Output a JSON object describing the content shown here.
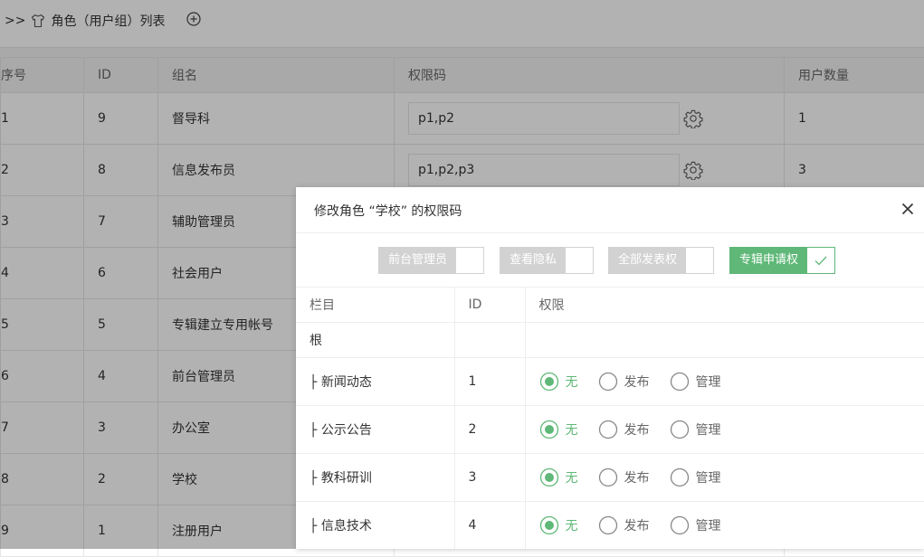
{
  "header": {
    "prefix": ">>",
    "title": "角色（用户组）列表"
  },
  "table": {
    "columns": [
      "序号",
      "ID",
      "组名",
      "权限码",
      "用户数量"
    ],
    "rows": [
      {
        "index": "1",
        "id": "9",
        "name": "督导科",
        "perm": "p1,p2",
        "count": "1"
      },
      {
        "index": "2",
        "id": "8",
        "name": "信息发布员",
        "perm": "p1,p2,p3",
        "count": "3"
      },
      {
        "index": "3",
        "id": "7",
        "name": "辅助管理员"
      },
      {
        "index": "4",
        "id": "6",
        "name": "社会用户"
      },
      {
        "index": "5",
        "id": "5",
        "name": "专辑建立专用帐号"
      },
      {
        "index": "6",
        "id": "4",
        "name": "前台管理员"
      },
      {
        "index": "7",
        "id": "3",
        "name": "办公室"
      },
      {
        "index": "8",
        "id": "2",
        "name": "学校"
      },
      {
        "index": "9",
        "id": "1",
        "name": "注册用户"
      }
    ]
  },
  "modal": {
    "title": "修改角色 “学校” 的权限码",
    "toggles": [
      {
        "label": "前台管理员",
        "on": false
      },
      {
        "label": "查看隐私",
        "on": false
      },
      {
        "label": "全部发表权",
        "on": false
      },
      {
        "label": "专辑申请权",
        "on": true
      }
    ],
    "columns": [
      "栏目",
      "ID",
      "权限"
    ],
    "root_label": "根",
    "options": [
      "无",
      "发布",
      "管理"
    ],
    "items": [
      {
        "label": "├ 新闻动态",
        "id": "1",
        "selected": "无"
      },
      {
        "label": "├ 公示公告",
        "id": "2",
        "selected": "无"
      },
      {
        "label": "├ 教科研训",
        "id": "3",
        "selected": "无"
      },
      {
        "label": "├ 信息技术",
        "id": "4",
        "selected": "无"
      }
    ]
  },
  "colors": {
    "accent": "#5fb878",
    "switch_off": "#d2d2d2",
    "overlay": "rgba(0,0,0,0.3)"
  }
}
